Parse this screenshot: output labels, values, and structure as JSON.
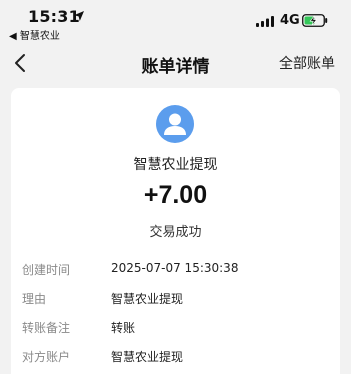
{
  "status_bar": {
    "time": "15:31",
    "back_app": "◀ 智慧农业",
    "network": "4G",
    "icons": [
      "location-arrow-icon",
      "signal-icon",
      "battery-charging-icon"
    ]
  },
  "nav": {
    "back_icon": "chevron-left-icon",
    "title": "账单详情",
    "right_link": "全部账单"
  },
  "summary": {
    "avatar_icon": "person-icon",
    "avatar_color": "#5b9ded",
    "payee": "智慧农业提现",
    "amount": "+7.00",
    "status": "交易成功"
  },
  "details": [
    {
      "label": "创建时间",
      "value": "2025-07-07 15:30:38"
    },
    {
      "label": "理由",
      "value": "智慧农业提现"
    },
    {
      "label": "转账备注",
      "value": "转账"
    },
    {
      "label": "对方账户",
      "value": "智慧农业提现"
    }
  ]
}
